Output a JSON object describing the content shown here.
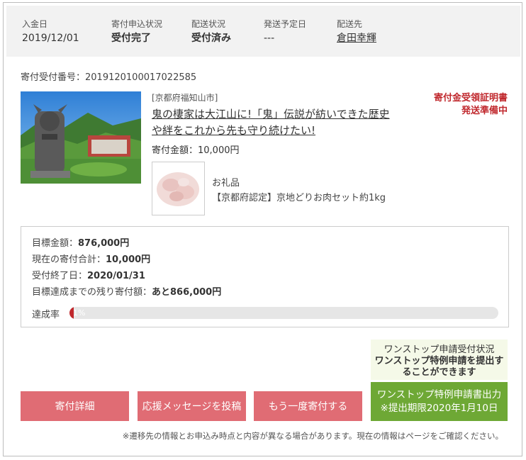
{
  "info": {
    "deposit_date_label": "入金日",
    "deposit_date": "2019/12/01",
    "application_status_label": "寄付申込状況",
    "application_status": "受付完了",
    "shipping_status_label": "配送状況",
    "shipping_status": "受付済み",
    "shipping_date_label": "発送予定日",
    "shipping_date": "---",
    "recipient_label": "配送先",
    "recipient": "倉田幸輝"
  },
  "receipt": {
    "text": "寄付受付番号：2019120100017022585"
  },
  "project": {
    "prefecture": "[京都府福知山市]",
    "title": "鬼の棲家は大江山に!「鬼」伝説が紡いできた歴史や絆をこれから先も守り続けたい!",
    "amount": "寄付金額：10,000円",
    "certificate_line1": "寄付金受領証明書",
    "certificate_line2": "発送準備中"
  },
  "gift": {
    "label": "お礼品",
    "name": "【京都府認定】京地どりお肉セット約1kg"
  },
  "goal": {
    "target_label": "目標金額：",
    "target_value": "876,000円",
    "current_label": "現在の寄付合計：",
    "current_value": "10,000円",
    "end_label": "受付終了日：",
    "end_value": "2020/01/31",
    "remaining_label": "目標達成までの残り寄付額：",
    "remaining_value": "あと866,000円",
    "progress_label": "達成率",
    "progress_text": "1%",
    "progress_percent": 1
  },
  "buttons": {
    "details": "寄付詳細",
    "message": "応援メッセージを投稿",
    "donate_again": "もう一度寄付する",
    "onestop_line1": "ワンストップ特例申請書出力",
    "onestop_line2": "※提出期限2020年1月10日"
  },
  "onestop_status": {
    "title": "ワンストップ申請受付状況",
    "message": "ワンストップ特例申請を提出することができます"
  },
  "note": "※遷移先の情報とお申込み時点と内容が異なる場合があります。現在の情報はページをご確認ください。",
  "colors": {
    "accent_red": "#c0282d",
    "button_pink": "#e06c74",
    "button_green": "#6ea835",
    "infobar_bg": "#f2f2f2"
  }
}
